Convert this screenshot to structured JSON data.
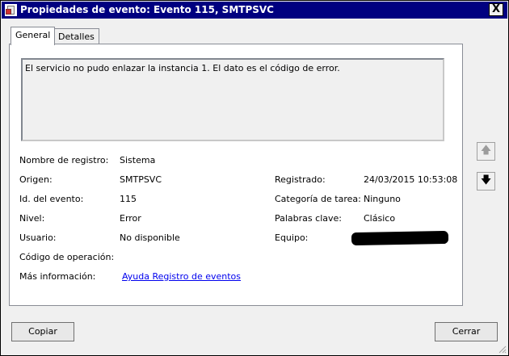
{
  "window": {
    "title": "Propiedades de evento: Evento 115, SMTPSVC",
    "close_glyph": "X"
  },
  "tabs": [
    {
      "label": "General"
    },
    {
      "label": "Detalles"
    }
  ],
  "description": "El servicio no pudo enlazar la instancia 1. El dato es el código de error.",
  "fields": {
    "nombre_registro": {
      "label": "Nombre de registro:",
      "value": "Sistema"
    },
    "origen": {
      "label": "Origen:",
      "value": "SMTPSVC"
    },
    "id_evento": {
      "label": "Id. del evento:",
      "value": "115"
    },
    "nivel": {
      "label": "Nivel:",
      "value": "Error"
    },
    "usuario": {
      "label": "Usuario:",
      "value": "No disponible"
    },
    "codigo_operacion": {
      "label": "Código de operación:",
      "value": ""
    },
    "mas_informacion": {
      "label": "Más información:",
      "value": "Ayuda Registro de eventos"
    },
    "registrado": {
      "label": "Registrado:",
      "value": "24/03/2015 10:53:08"
    },
    "categoria_tarea": {
      "label": "Categoría de tarea:",
      "value": "Ninguno"
    },
    "palabras_clave": {
      "label": "Palabras clave:",
      "value": "Clásico"
    },
    "equipo": {
      "label": "Equipo:",
      "value": ""
    }
  },
  "nav": {
    "up_glyph": "🡅",
    "down_glyph": "🡇"
  },
  "buttons": {
    "copy": "Copiar",
    "close": "Cerrar"
  },
  "icons": {
    "app": "event-viewer-icon",
    "up": "arrow-up-icon",
    "down": "arrow-down-icon",
    "close": "close-icon"
  }
}
